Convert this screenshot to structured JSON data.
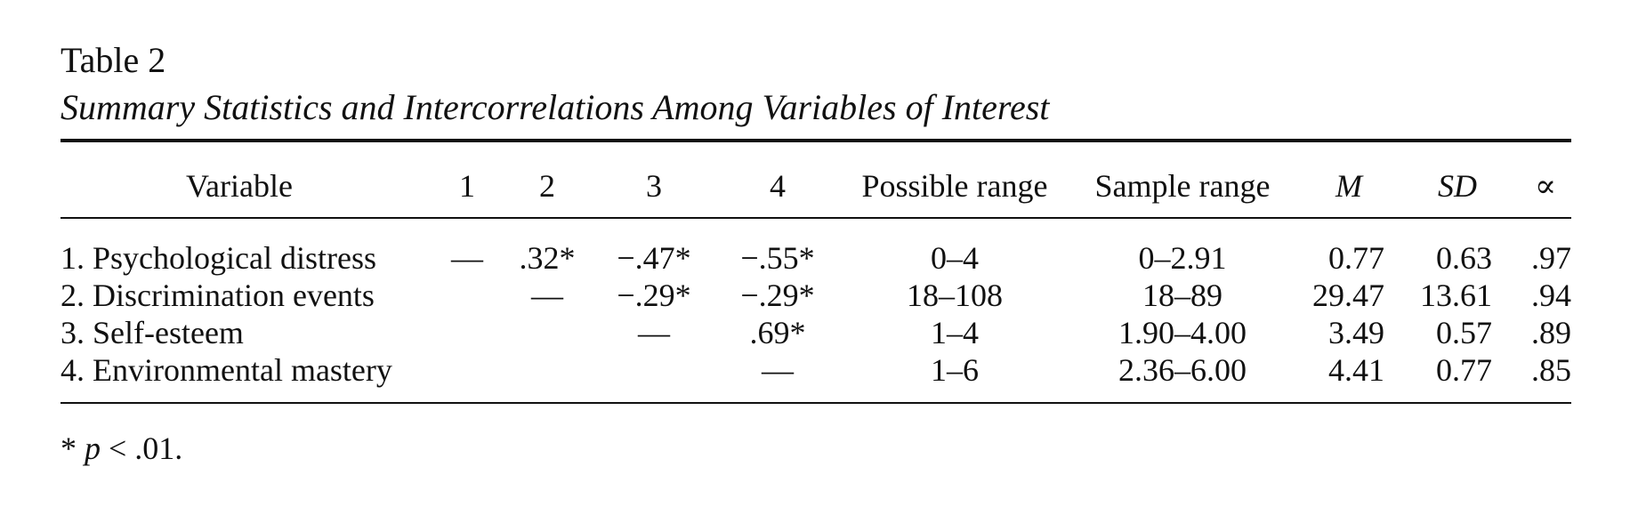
{
  "table_label": "Table 2",
  "table_title": "Summary Statistics and Intercorrelations Among Variables of Interest",
  "headers": {
    "variable": "Variable",
    "c1": "1",
    "c2": "2",
    "c3": "3",
    "c4": "4",
    "possible_range": "Possible range",
    "sample_range": "Sample range",
    "m": "M",
    "sd": "SD",
    "alpha": "∝"
  },
  "rows": [
    {
      "variable": "1. Psychological distress",
      "c1": "—",
      "c2": ".32*",
      "c3": "−.47*",
      "c4": "−.55*",
      "possible_range": "0–4",
      "sample_range": "0–2.91",
      "m": "0.77",
      "sd": "0.63",
      "alpha": ".97"
    },
    {
      "variable": "2. Discrimination events",
      "c1": "",
      "c2": "—",
      "c3": "−.29*",
      "c4": "−.29*",
      "possible_range": "18–108",
      "sample_range": "18–89",
      "m": "29.47",
      "sd": "13.61",
      "alpha": ".94"
    },
    {
      "variable": "3. Self-esteem",
      "c1": "",
      "c2": "",
      "c3": "—",
      "c4": ".69*",
      "possible_range": "1–4",
      "sample_range": "1.90–4.00",
      "m": "3.49",
      "sd": "0.57",
      "alpha": ".89"
    },
    {
      "variable": "4. Environmental mastery",
      "c1": "",
      "c2": "",
      "c3": "",
      "c4": "—",
      "possible_range": "1–6",
      "sample_range": "2.36–6.00",
      "m": "4.41",
      "sd": "0.77",
      "alpha": ".85"
    }
  ],
  "note": {
    "star": "* ",
    "p": "p",
    "rest": " < .01."
  }
}
